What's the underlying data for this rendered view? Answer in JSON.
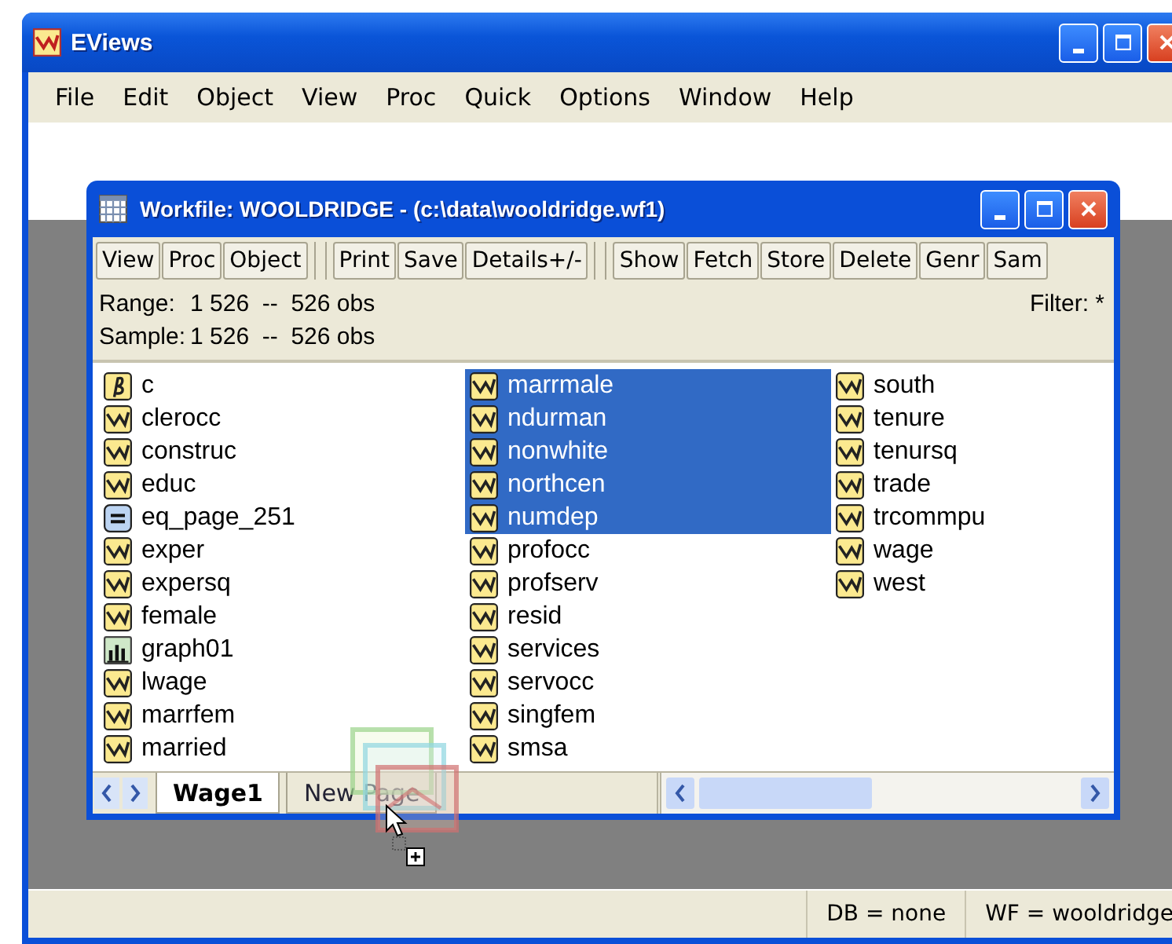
{
  "window": {
    "title": "EViews"
  },
  "menu": [
    "File",
    "Edit",
    "Object",
    "View",
    "Proc",
    "Quick",
    "Options",
    "Window",
    "Help"
  ],
  "workfile": {
    "title": "Workfile: WOOLDRIDGE - (c:\\data\\wooldridge.wf1)",
    "toolbar": [
      {
        "buttons": [
          "View",
          "Proc",
          "Object"
        ]
      },
      {
        "buttons": [
          "Print",
          "Save",
          "Details+/-"
        ]
      },
      {
        "buttons": [
          "Show",
          "Fetch",
          "Store",
          "Delete",
          "Genr",
          "Sam"
        ]
      }
    ],
    "range": {
      "label": "Range:",
      "value": "1 526  --  526 obs"
    },
    "sample": {
      "label": "Sample:",
      "value": "1 526  --  526 obs"
    },
    "filter": "Filter: *",
    "columns": [
      {
        "items": [
          {
            "name": "c",
            "kind": "coef",
            "selected": false
          },
          {
            "name": "clerocc",
            "kind": "series",
            "selected": false
          },
          {
            "name": "construc",
            "kind": "series",
            "selected": false
          },
          {
            "name": "educ",
            "kind": "series",
            "selected": false
          },
          {
            "name": "eq_page_251",
            "kind": "equation",
            "selected": false
          },
          {
            "name": "exper",
            "kind": "series",
            "selected": false
          },
          {
            "name": "expersq",
            "kind": "series",
            "selected": false
          },
          {
            "name": "female",
            "kind": "series",
            "selected": false
          },
          {
            "name": "graph01",
            "kind": "graph",
            "selected": false
          },
          {
            "name": "lwage",
            "kind": "series",
            "selected": false
          },
          {
            "name": "marrfem",
            "kind": "series",
            "selected": false
          },
          {
            "name": "married",
            "kind": "series",
            "selected": false
          }
        ]
      },
      {
        "items": [
          {
            "name": "marrmale",
            "kind": "series",
            "selected": true
          },
          {
            "name": "ndurman",
            "kind": "series",
            "selected": true
          },
          {
            "name": "nonwhite",
            "kind": "series",
            "selected": true
          },
          {
            "name": "northcen",
            "kind": "series",
            "selected": true
          },
          {
            "name": "numdep",
            "kind": "series",
            "selected": true
          },
          {
            "name": "profocc",
            "kind": "series",
            "selected": false
          },
          {
            "name": "profserv",
            "kind": "series",
            "selected": false
          },
          {
            "name": "resid",
            "kind": "series",
            "selected": false
          },
          {
            "name": "services",
            "kind": "series",
            "selected": false
          },
          {
            "name": "servocc",
            "kind": "series",
            "selected": false
          },
          {
            "name": "singfem",
            "kind": "series",
            "selected": false
          },
          {
            "name": "smsa",
            "kind": "series",
            "selected": false
          }
        ]
      },
      {
        "items": [
          {
            "name": "south",
            "kind": "series",
            "selected": false
          },
          {
            "name": "tenure",
            "kind": "series",
            "selected": false
          },
          {
            "name": "tenursq",
            "kind": "series",
            "selected": false
          },
          {
            "name": "trade",
            "kind": "series",
            "selected": false
          },
          {
            "name": "trcommpu",
            "kind": "series",
            "selected": false
          },
          {
            "name": "wage",
            "kind": "series",
            "selected": false
          },
          {
            "name": "west",
            "kind": "series",
            "selected": false
          }
        ]
      }
    ],
    "tabs": [
      {
        "label": "Wage1",
        "selected": true
      },
      {
        "label": "New Page",
        "selected": false
      }
    ]
  },
  "status_bar": [
    "DB = none",
    "WF = wooldridge"
  ]
}
